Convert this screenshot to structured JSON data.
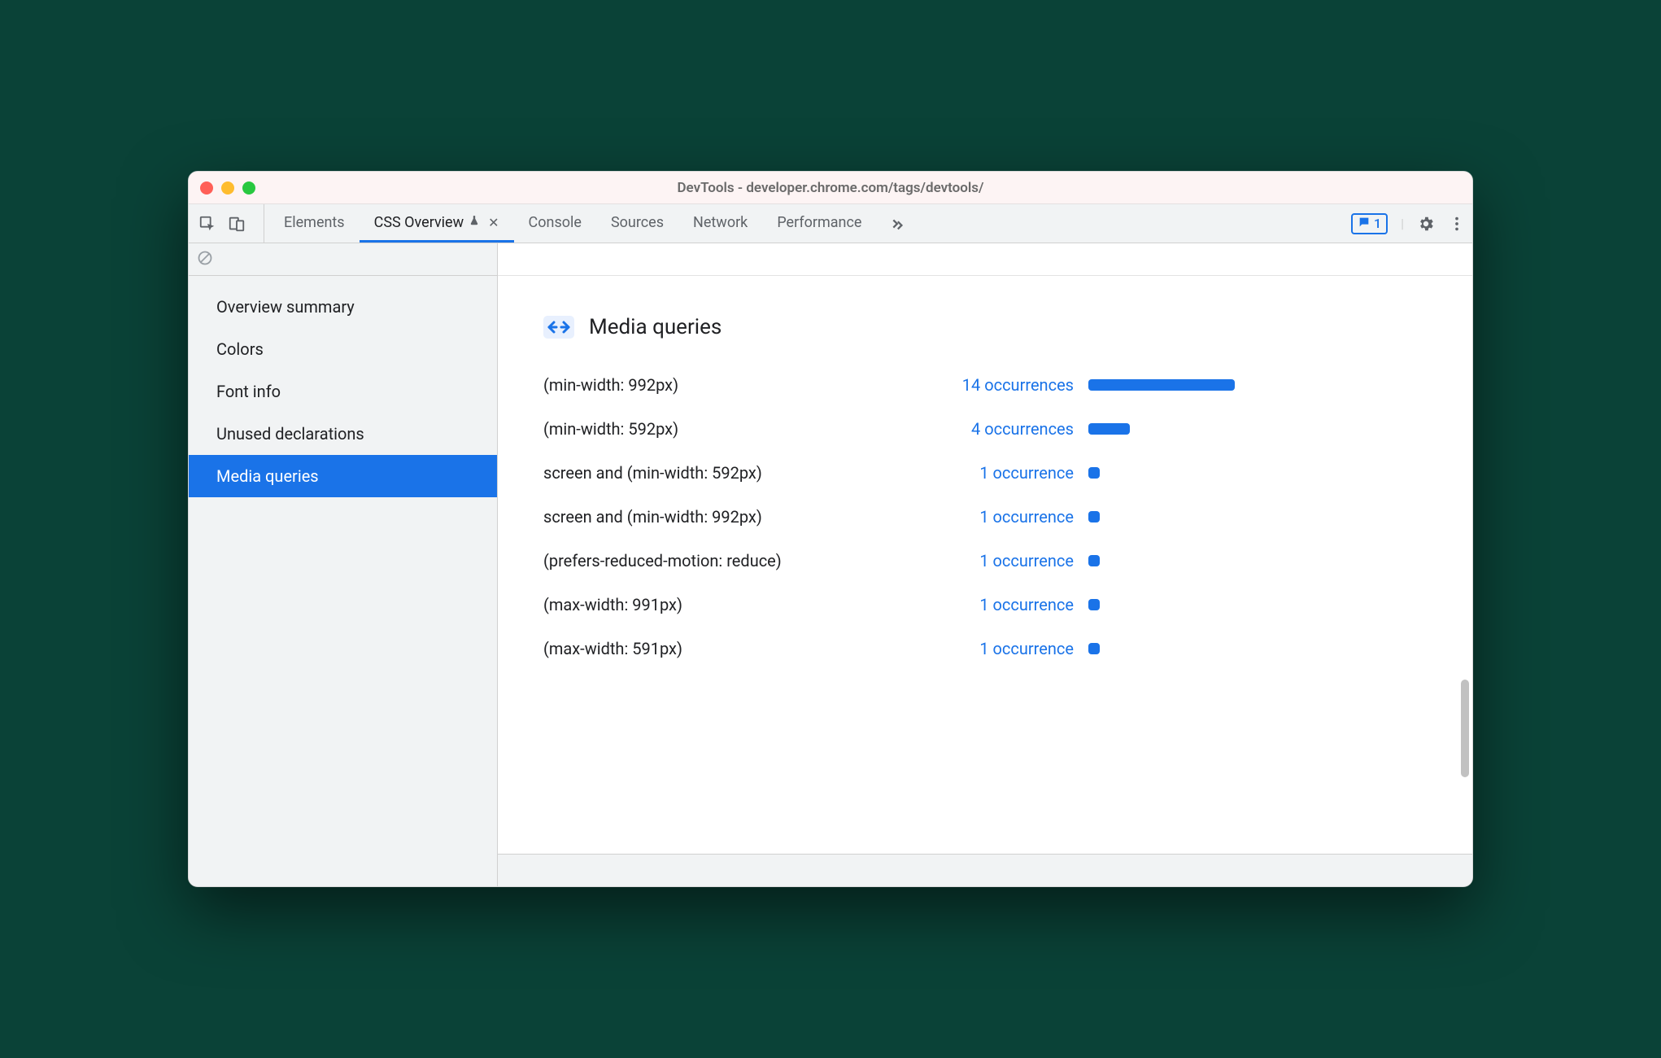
{
  "window": {
    "title": "DevTools - developer.chrome.com/tags/devtools/"
  },
  "toolbar": {
    "tabs": [
      "Elements",
      "CSS Overview",
      "Console",
      "Sources",
      "Network",
      "Performance"
    ],
    "active_tab_index": 1,
    "issues_count": "1"
  },
  "sidebar": {
    "items": [
      "Overview summary",
      "Colors",
      "Font info",
      "Unused declarations",
      "Media queries"
    ],
    "selected_index": 4
  },
  "section": {
    "title": "Media queries"
  },
  "chart_data": {
    "type": "bar",
    "title": "Media queries",
    "xlabel": "occurrences",
    "categories": [
      "(min-width: 992px)",
      "(min-width: 592px)",
      "screen and (min-width: 592px)",
      "screen and (min-width: 992px)",
      "(prefers-reduced-motion: reduce)",
      "(max-width: 991px)",
      "(max-width: 591px)"
    ],
    "values": [
      14,
      4,
      1,
      1,
      1,
      1,
      1
    ],
    "labels": [
      "14 occurrences",
      "4 occurrences",
      "1 occurrence",
      "1 occurrence",
      "1 occurrence",
      "1 occurrence",
      "1 occurrence"
    ]
  },
  "colors": {
    "accent": "#1a73e8"
  }
}
